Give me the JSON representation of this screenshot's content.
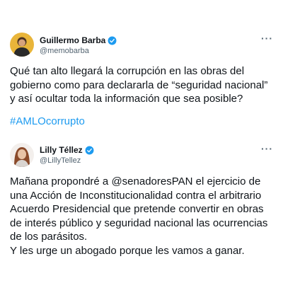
{
  "tweets": [
    {
      "display_name": "Guillermo Barba",
      "handle": "@memobarba",
      "verified": true,
      "more_label": "···",
      "text_lines": [
        "Qué tan alto llegará la corrupción en las obras del",
        "gobierno como para declararla de “seguridad nacional”",
        "y así ocultar toda la información que sea posible?"
      ],
      "hashtag": "#AMLOcorrupto"
    },
    {
      "display_name": "Lilly Téllez",
      "handle": "@LillyTellez",
      "verified": true,
      "more_label": "···",
      "text_lines": [
        "Mañana propondré a @senadoresPAN el ejercicio de",
        "una Acción de Inconstitucionalidad contra el arbitrario",
        "Acuerdo Presidencial que pretende convertir en obras",
        "de interés público y seguridad nacional las ocurrencias",
        "de los parásitos.",
        "Y les urge un abogado porque les vamos a ganar."
      ]
    }
  ],
  "colors": {
    "verified_badge": "#1d9bf0",
    "hashtag": "#1d9bf0",
    "text": "#0f1419",
    "secondary_text": "#536471"
  },
  "icons": {
    "verified": "verified-badge-icon",
    "more": "more-options-icon"
  }
}
